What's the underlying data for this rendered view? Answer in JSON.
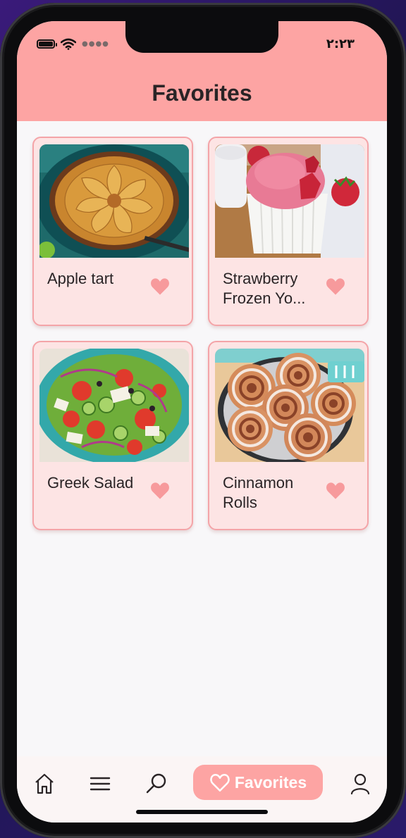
{
  "status_bar": {
    "time": "٢:٢٣",
    "icons": [
      "battery-icon",
      "wifi-icon",
      "cellular-dots-icon"
    ]
  },
  "header": {
    "title": "Favorites"
  },
  "favorites": [
    {
      "name": "Apple tart",
      "image": "apple-tart-photo",
      "favorited": true
    },
    {
      "name": "Strawberry Frozen Yo...",
      "image": "strawberry-frozen-yogurt-photo",
      "favorited": true
    },
    {
      "name": "Greek Salad",
      "image": "greek-salad-photo",
      "favorited": true
    },
    {
      "name": "Cinnamon Rolls",
      "image": "cinnamon-rolls-photo",
      "favorited": true
    }
  ],
  "bottom_nav": {
    "items": [
      {
        "icon": "home-icon"
      },
      {
        "icon": "menu-icon"
      },
      {
        "icon": "search-icon"
      },
      {
        "icon": "heart-icon",
        "label": "Favorites",
        "active": true
      },
      {
        "icon": "profile-icon"
      }
    ]
  },
  "colors": {
    "header_bg": "#fda4a3",
    "card_bg": "#fde4e4",
    "card_border": "#f4a4a8",
    "heart": "#f79a9c",
    "text": "#2a2426"
  }
}
